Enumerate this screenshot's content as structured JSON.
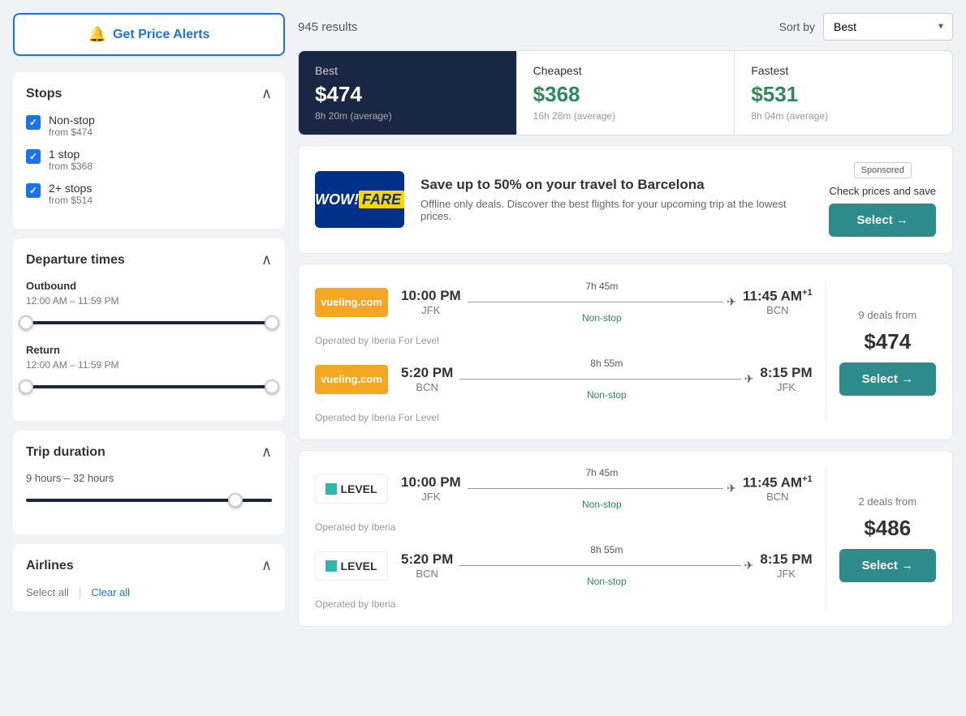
{
  "sidebar": {
    "alert_button": "Get Price Alerts",
    "stops_title": "Stops",
    "stops": [
      {
        "label": "Non-stop",
        "price": "from $474",
        "checked": true
      },
      {
        "label": "1 stop",
        "price": "from $368",
        "checked": true
      },
      {
        "label": "2+ stops",
        "price": "from $514",
        "checked": true
      }
    ],
    "departure_title": "Departure times",
    "outbound_label": "Outbound",
    "outbound_range": "12:00 AM – 11:59 PM",
    "return_label": "Return",
    "return_range": "12:00 AM – 11:59 PM",
    "trip_duration_title": "Trip duration",
    "trip_duration_range": "9 hours – 32 hours",
    "airlines_title": "Airlines",
    "select_all": "Select all",
    "clear_all": "Clear all"
  },
  "header": {
    "results_count": "945 results",
    "sort_label": "Sort by",
    "sort_value": "Best"
  },
  "price_tabs": [
    {
      "label": "Best",
      "price": "$474",
      "duration": "8h 20m (average)",
      "active": true,
      "color": "white"
    },
    {
      "label": "Cheapest",
      "price": "$368",
      "duration": "16h 28m (average)",
      "active": false,
      "color": "cheapest"
    },
    {
      "label": "Fastest",
      "price": "$531",
      "duration": "8h 04m (average)",
      "active": false,
      "color": "fastest"
    }
  ],
  "ad_card": {
    "logo_text_wow": "WOW!",
    "logo_text_fare": "FARE",
    "title": "Save up to 50% on your travel to Barcelona",
    "description": "Offline only deals. Discover the best flights for your upcoming trip at the lowest prices.",
    "sponsored": "Sponsored",
    "action_text": "Check prices and save",
    "button_label": "Select →"
  },
  "flights": [
    {
      "id": "flight-1",
      "airline": "vueling",
      "airline_display": "vueling.com",
      "outbound": {
        "departure_time": "10:00 PM",
        "departure_airport": "JFK",
        "duration": "7h 45m",
        "nonstop": "Non-stop",
        "arrival_time": "11:45 AM",
        "arrival_superscript": "+1",
        "arrival_airport": "BCN"
      },
      "operated_outbound": "Operated by Iberia For Level",
      "inbound": {
        "departure_time": "5:20 PM",
        "departure_airport": "BCN",
        "duration": "8h 55m",
        "nonstop": "Non-stop",
        "arrival_time": "8:15 PM",
        "arrival_airport": "JFK"
      },
      "operated_inbound": "Operated by Iberia For Level",
      "deals_from": "9 deals from",
      "price": "$474",
      "button_label": "Select →"
    },
    {
      "id": "flight-2",
      "airline": "level",
      "airline_display": "LEVEL",
      "outbound": {
        "departure_time": "10:00 PM",
        "departure_airport": "JFK",
        "duration": "7h 45m",
        "nonstop": "Non-stop",
        "arrival_time": "11:45 AM",
        "arrival_superscript": "+1",
        "arrival_airport": "BCN"
      },
      "operated_outbound": "Operated by Iberia",
      "inbound": {
        "departure_time": "5:20 PM",
        "departure_airport": "BCN",
        "duration": "8h 55m",
        "nonstop": "Non-stop",
        "arrival_time": "8:15 PM",
        "arrival_airport": "JFK"
      },
      "operated_inbound": "Operated by Iberia",
      "deals_from": "2 deals from",
      "price": "$486",
      "button_label": "Select →"
    }
  ]
}
